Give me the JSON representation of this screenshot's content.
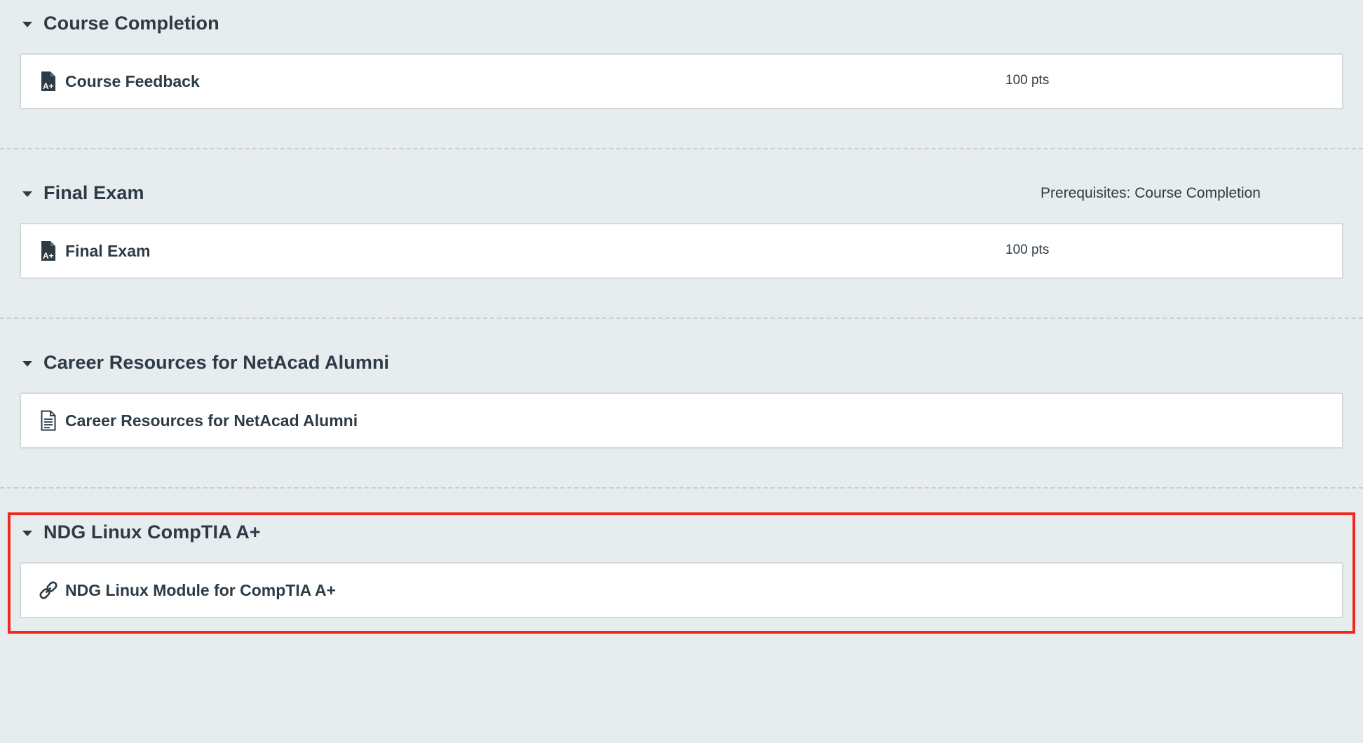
{
  "modules": [
    {
      "title": "Course Completion",
      "prerequisites": "",
      "items": [
        {
          "icon": "assignment-icon",
          "title": "Course Feedback",
          "points": "100 pts"
        }
      ]
    },
    {
      "title": "Final Exam",
      "prerequisites": "Prerequisites: Course Completion",
      "items": [
        {
          "icon": "assignment-icon",
          "title": "Final Exam",
          "points": "100 pts"
        }
      ]
    },
    {
      "title": "Career Resources for NetAcad Alumni",
      "prerequisites": "",
      "items": [
        {
          "icon": "page-icon",
          "title": "Career Resources for NetAcad Alumni",
          "points": ""
        }
      ]
    },
    {
      "title": "NDG Linux CompTIA A+",
      "prerequisites": "",
      "items": [
        {
          "icon": "link-icon",
          "title": "NDG Linux Module for CompTIA A+",
          "points": ""
        }
      ]
    }
  ],
  "colors": {
    "background": "#e7ecef",
    "text": "#2d3b45",
    "highlight": "#ee2a1c",
    "card_border": "#d3d9dd"
  }
}
